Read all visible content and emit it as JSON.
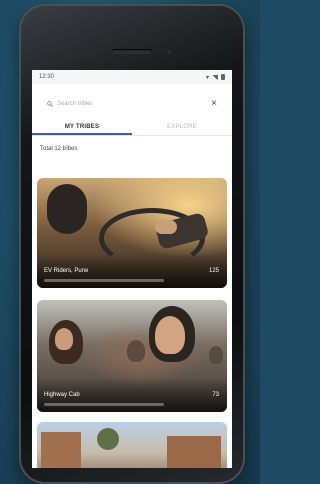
{
  "status_bar": {
    "time": "12:30",
    "icons": [
      "wifi-icon",
      "signal-icon",
      "battery-icon"
    ]
  },
  "search": {
    "placeholder": "Search tribes",
    "icon": "search-icon",
    "clear_icon": "close-icon"
  },
  "tabs": [
    {
      "label": "MY TRIBES",
      "active": true
    },
    {
      "label": "EXPLORE",
      "active": false
    }
  ],
  "summary": {
    "count_label": "Total 12 tribes"
  },
  "tribes": [
    {
      "name": "EV Riders, Pune",
      "members": "125"
    },
    {
      "name": "Highway Cab",
      "members": "73"
    },
    {
      "name": "",
      "members": ""
    }
  ],
  "colors": {
    "background": "#1f4a63",
    "accent": "#3c5ea8",
    "screen": "#ffffff"
  }
}
